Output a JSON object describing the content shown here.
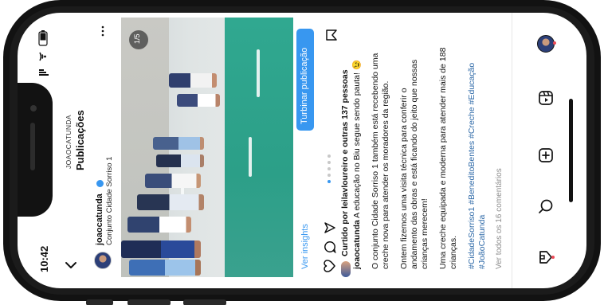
{
  "status_bar": {
    "time": "10:42"
  },
  "header": {
    "account_caps": "JOAOCATUNDA",
    "title": "Publicações"
  },
  "post": {
    "username": "joaocatunda",
    "location": "Conjunto Cidade Sorriso 1",
    "image_counter": "1/5",
    "insights_link": "Ver insights",
    "boost_button": "Turbinar publicação",
    "liked_by": "Curtido por leilavloureiro e outras 137 pessoas",
    "caption_user": "joaocatunda",
    "caption_first": "A educação no Biu segue sendo pauta! 😉",
    "paragraph_1": [
      "O conjunto Cidade Sorriso 1 também está recebendo uma",
      "creche nova para atender os moradores da região."
    ],
    "paragraph_2": [
      "Ontem fizemos uma visita técnica para conferir o",
      "andamento das obras e está ficando do jeito que nossas",
      "crianças merecem!"
    ],
    "paragraph_3": [
      "Uma creche equipada e moderna para atender mais de 188",
      "crianças."
    ],
    "hashtags": [
      "#CidadeSorriso1 #BeneditoBentes #Creche #Educação",
      "#JoãoCatunda"
    ],
    "comments_link": "Ver todos os 16 comentários",
    "carousel_total": 5,
    "carousel_index": 1
  },
  "colors": {
    "accent": "#3897f0",
    "link": "#2f6aa8",
    "notification_dot": "#ed4956"
  },
  "icons": {
    "back": "back-arrow-icon",
    "more": "more-options-icon",
    "like": "heart-icon",
    "comment": "comment-icon",
    "share": "paper-plane-icon",
    "save": "bookmark-icon",
    "home": "home-icon",
    "search": "search-icon",
    "create": "plus-square-icon",
    "reels": "reels-icon",
    "profile": "profile-avatar"
  }
}
